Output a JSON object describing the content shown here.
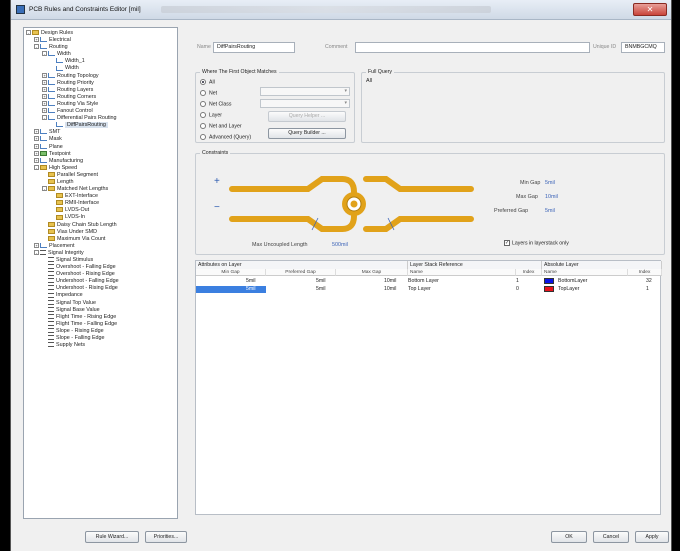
{
  "window": {
    "title": "PCB Rules and Constraints Editor [mil]",
    "close_glyph": "✕"
  },
  "tree": [
    {
      "label": "Design Rules",
      "level": 0,
      "exp": "-",
      "icon": "folder"
    },
    {
      "label": "Electrical",
      "level": 1,
      "exp": "+",
      "icon": "rule"
    },
    {
      "label": "Routing",
      "level": 1,
      "exp": "-",
      "icon": "rule"
    },
    {
      "label": "Width",
      "level": 2,
      "exp": "-",
      "icon": "rule"
    },
    {
      "label": "Width_1",
      "level": 3,
      "exp": "",
      "icon": "rule"
    },
    {
      "label": "Width",
      "level": 3,
      "exp": "",
      "icon": "rule"
    },
    {
      "label": "Routing Topology",
      "level": 2,
      "exp": "+",
      "icon": "rule"
    },
    {
      "label": "Routing Priority",
      "level": 2,
      "exp": "+",
      "icon": "rule"
    },
    {
      "label": "Routing Layers",
      "level": 2,
      "exp": "+",
      "icon": "rule"
    },
    {
      "label": "Routing Corners",
      "level": 2,
      "exp": "+",
      "icon": "rule"
    },
    {
      "label": "Routing Via Style",
      "level": 2,
      "exp": "+",
      "icon": "rule"
    },
    {
      "label": "Fanout Control",
      "level": 2,
      "exp": "+",
      "icon": "rule"
    },
    {
      "label": "Differential Pairs Routing",
      "level": 2,
      "exp": "-",
      "icon": "rule"
    },
    {
      "label": "DiffPairsRouting",
      "level": 3,
      "exp": "",
      "icon": "rule",
      "selected": true
    },
    {
      "label": "SMT",
      "level": 1,
      "exp": "+",
      "icon": "rule"
    },
    {
      "label": "Mask",
      "level": 1,
      "exp": "+",
      "icon": "rule"
    },
    {
      "label": "Plane",
      "level": 1,
      "exp": "+",
      "icon": "rule"
    },
    {
      "label": "Testpoint",
      "level": 1,
      "exp": "+",
      "icon": "green"
    },
    {
      "label": "Manufacturing",
      "level": 1,
      "exp": "+",
      "icon": "rule"
    },
    {
      "label": "High Speed",
      "level": 1,
      "exp": "-",
      "icon": "folder"
    },
    {
      "label": "Parallel Segment",
      "level": 2,
      "exp": "",
      "icon": "folder"
    },
    {
      "label": "Length",
      "level": 2,
      "exp": "",
      "icon": "folder"
    },
    {
      "label": "Matched Net Lengths",
      "level": 2,
      "exp": "-",
      "icon": "folder"
    },
    {
      "label": "EXT-Interface",
      "level": 3,
      "exp": "",
      "icon": "folder"
    },
    {
      "label": "RMII-Interface",
      "level": 3,
      "exp": "",
      "icon": "folder"
    },
    {
      "label": "LVDS-Out",
      "level": 3,
      "exp": "",
      "icon": "folder"
    },
    {
      "label": "LVDS-In",
      "level": 3,
      "exp": "",
      "icon": "folder"
    },
    {
      "label": "Daisy Chain Stub Length",
      "level": 2,
      "exp": "",
      "icon": "folder"
    },
    {
      "label": "Vias Under SMD",
      "level": 2,
      "exp": "",
      "icon": "folder"
    },
    {
      "label": "Maximum Via Count",
      "level": 2,
      "exp": "",
      "icon": "folder"
    },
    {
      "label": "Placement",
      "level": 1,
      "exp": "+",
      "icon": "rule"
    },
    {
      "label": "Signal Integrity",
      "level": 1,
      "exp": "-",
      "icon": "sig"
    },
    {
      "label": "Signal Stimulus",
      "level": 2,
      "exp": "",
      "icon": "sig"
    },
    {
      "label": "Overshoot - Falling Edge",
      "level": 2,
      "exp": "",
      "icon": "sig"
    },
    {
      "label": "Overshoot - Rising Edge",
      "level": 2,
      "exp": "",
      "icon": "sig"
    },
    {
      "label": "Undershoot - Falling Edge",
      "level": 2,
      "exp": "",
      "icon": "sig"
    },
    {
      "label": "Undershoot - Rising Edge",
      "level": 2,
      "exp": "",
      "icon": "sig"
    },
    {
      "label": "Impedance",
      "level": 2,
      "exp": "",
      "icon": "sig"
    },
    {
      "label": "Signal Top Value",
      "level": 2,
      "exp": "",
      "icon": "sig"
    },
    {
      "label": "Signal Base Value",
      "level": 2,
      "exp": "",
      "icon": "sig"
    },
    {
      "label": "Flight Time - Rising Edge",
      "level": 2,
      "exp": "",
      "icon": "sig"
    },
    {
      "label": "Flight Time - Falling Edge",
      "level": 2,
      "exp": "",
      "icon": "sig"
    },
    {
      "label": "Slope - Rising Edge",
      "level": 2,
      "exp": "",
      "icon": "sig"
    },
    {
      "label": "Slope - Falling Edge",
      "level": 2,
      "exp": "",
      "icon": "sig"
    },
    {
      "label": "Supply Nets",
      "level": 2,
      "exp": "",
      "icon": "sig"
    }
  ],
  "rule": {
    "name_label": "Name",
    "name_value": "DiffPairsRouting",
    "comment_label": "Comment",
    "comment_value": "",
    "uid_label": "Unique ID",
    "uid_value": "BNMBGCMQ"
  },
  "match": {
    "title": "Where The First Object Matches",
    "options": [
      "All",
      "Net",
      "Net Class",
      "Layer",
      "Net and Layer",
      "Advanced (Query)"
    ],
    "selected": 0,
    "query_helper": "Query Helper ...",
    "query_builder": "Query Builder ..."
  },
  "full_query": {
    "title": "Full Query",
    "text": "All"
  },
  "constraints": {
    "title": "Constraints",
    "plus": "+",
    "minus": "−",
    "min_gap_label": "Min Gap",
    "min_gap": "5mil",
    "max_gap_label": "Max Gap",
    "max_gap": "10mil",
    "pref_gap_label": "Preferred Gap",
    "pref_gap": "5mil",
    "uncoupled_label": "Max Uncoupled Length",
    "uncoupled": "500mil",
    "layers_stack_label": "Layers in layerstack only",
    "layers_stack_checked": "✓"
  },
  "layer_table": {
    "group_attr": "Attributes on Layer",
    "group_stack": "Layer Stack Reference",
    "group_abs": "Absolute Layer",
    "col_min": "Min Gap",
    "col_pref": "Preferred Gap",
    "col_max": "Max Gap",
    "col_name": "Name",
    "col_index": "Index",
    "col_abs_name": "Name",
    "col_abs_index": "Index",
    "rows": [
      {
        "min": "5mil",
        "pref": "5mil",
        "max": "10mil",
        "name": "Bottom Layer",
        "index": "1",
        "abs_name": "BottomLayer",
        "abs_index": "32",
        "color": "#0a14e6"
      },
      {
        "min": "5mil",
        "pref": "5mil",
        "max": "10mil",
        "name": "Top Layer",
        "index": "0",
        "abs_name": "TopLayer",
        "abs_index": "1",
        "color": "#e8141c"
      }
    ]
  },
  "footer": {
    "rule_wizard": "Rule Wizard...",
    "priorities": "Priorities...",
    "ok": "OK",
    "cancel": "Cancel",
    "apply": "Apply"
  }
}
